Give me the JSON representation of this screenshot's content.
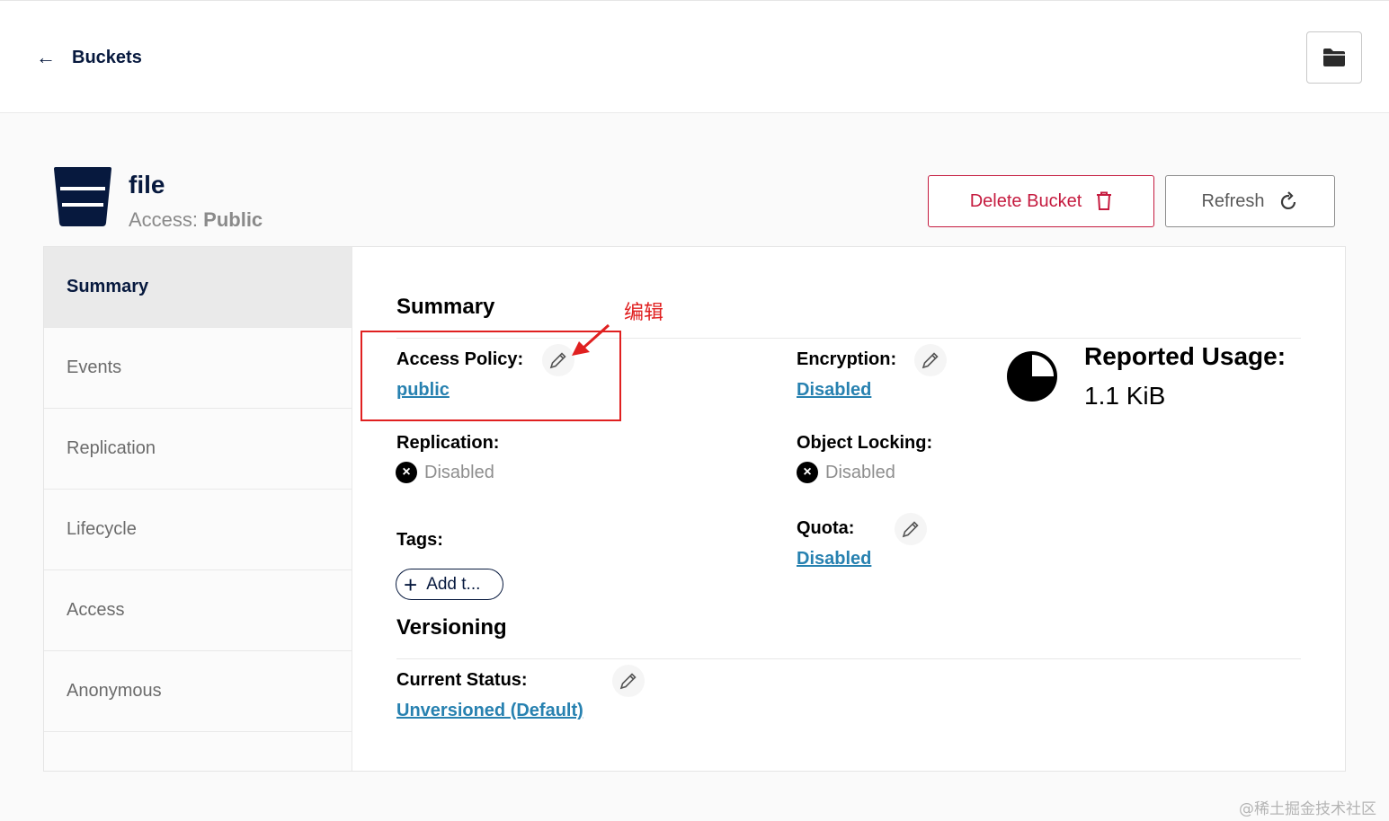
{
  "header": {
    "back_label": "Buckets"
  },
  "bucket": {
    "name": "file",
    "access_label": "Access:",
    "access_value": "Public"
  },
  "actions": {
    "delete_label": "Delete Bucket",
    "refresh_label": "Refresh"
  },
  "sidebar": {
    "items": [
      {
        "label": "Summary",
        "active": true
      },
      {
        "label": "Events"
      },
      {
        "label": "Replication"
      },
      {
        "label": "Lifecycle"
      },
      {
        "label": "Access"
      },
      {
        "label": "Anonymous"
      }
    ]
  },
  "summary": {
    "title": "Summary",
    "access_policy": {
      "label": "Access Policy:",
      "value": "public"
    },
    "encryption": {
      "label": "Encryption:",
      "value": "Disabled"
    },
    "replication": {
      "label": "Replication:",
      "value": "Disabled"
    },
    "object_locking": {
      "label": "Object Locking:",
      "value": "Disabled"
    },
    "tags": {
      "label": "Tags:",
      "add_label": "Add t..."
    },
    "quota": {
      "label": "Quota:",
      "value": "Disabled"
    },
    "usage": {
      "label": "Reported Usage:",
      "value": "1.1 KiB"
    }
  },
  "versioning": {
    "title": "Versioning",
    "status_label": "Current Status:",
    "status_value": "Unversioned (Default)"
  },
  "annotation": {
    "text": "编辑",
    "color": "#e02020"
  },
  "watermark": "@稀土掘金技术社区"
}
